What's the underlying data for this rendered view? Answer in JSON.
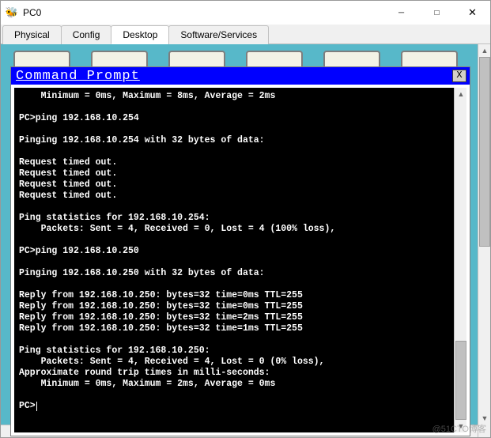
{
  "window": {
    "title": "PC0",
    "controls": {
      "minimize": "🗕",
      "maximize": "□",
      "close": "✕"
    }
  },
  "tabs": [
    {
      "label": "Physical",
      "active": false
    },
    {
      "label": "Config",
      "active": false
    },
    {
      "label": "Desktop",
      "active": true
    },
    {
      "label": "Software/Services",
      "active": false
    }
  ],
  "command_prompt": {
    "title": "Command Prompt",
    "close_label": "X",
    "lines": [
      "    Minimum = 0ms, Maximum = 8ms, Average = 2ms",
      "",
      "PC>ping 192.168.10.254",
      "",
      "Pinging 192.168.10.254 with 32 bytes of data:",
      "",
      "Request timed out.",
      "Request timed out.",
      "Request timed out.",
      "Request timed out.",
      "",
      "Ping statistics for 192.168.10.254:",
      "    Packets: Sent = 4, Received = 0, Lost = 4 (100% loss),",
      "",
      "PC>ping 192.168.10.250",
      "",
      "Pinging 192.168.10.250 with 32 bytes of data:",
      "",
      "Reply from 192.168.10.250: bytes=32 time=0ms TTL=255",
      "Reply from 192.168.10.250: bytes=32 time=0ms TTL=255",
      "Reply from 192.168.10.250: bytes=32 time=2ms TTL=255",
      "Reply from 192.168.10.250: bytes=32 time=1ms TTL=255",
      "",
      "Ping statistics for 192.168.10.250:",
      "    Packets: Sent = 4, Received = 4, Lost = 0 (0% loss),",
      "Approximate round trip times in milli-seconds:",
      "    Minimum = 0ms, Maximum = 2ms, Average = 0ms",
      "",
      "PC>"
    ]
  },
  "watermark": "@51CTO博客"
}
